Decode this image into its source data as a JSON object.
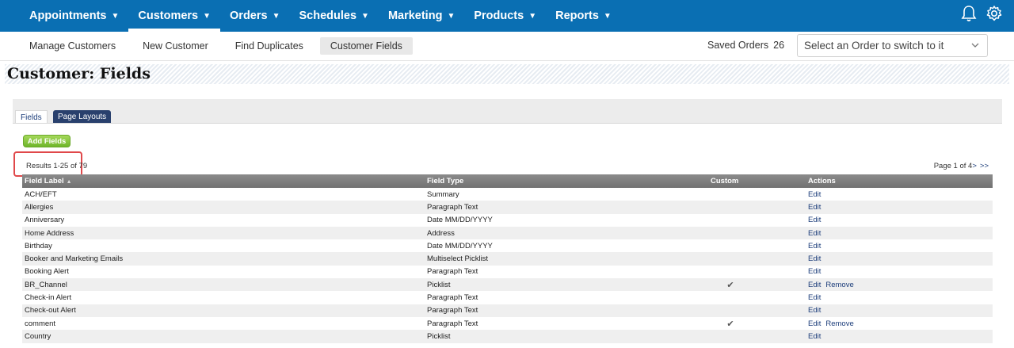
{
  "nav": {
    "items": [
      {
        "label": "Appointments",
        "caret": "▼"
      },
      {
        "label": "Customers",
        "caret": "▼",
        "active": true
      },
      {
        "label": "Orders",
        "caret": "▼"
      },
      {
        "label": "Schedules",
        "caret": "▼"
      },
      {
        "label": "Marketing",
        "caret": "▼"
      },
      {
        "label": "Products",
        "caret": "▼"
      },
      {
        "label": "Reports",
        "caret": "▼"
      }
    ],
    "icons": [
      "bell-icon",
      "gear-icon"
    ],
    "bg_color": "#0a6fb3"
  },
  "subnav": {
    "links": [
      "Manage Customers",
      "New Customer",
      "Find Duplicates",
      "Customer Fields"
    ],
    "active_link": "Customer Fields",
    "saved_orders_label": "Saved Orders",
    "saved_orders_count": "26",
    "order_select_placeholder": "Select an Order to switch to it"
  },
  "page": {
    "title": "Customer: Fields"
  },
  "tabs": {
    "fields": "Fields",
    "page_layouts": "Page Layouts"
  },
  "add_button": "Add Fields",
  "results_text": "Results 1-25 of 79",
  "pager": {
    "text": "Page 1 of 4",
    "next": ">",
    "last": ">>"
  },
  "table": {
    "headers": {
      "label": "Field Label",
      "sort_indicator": "▲",
      "type": "Field Type",
      "custom": "Custom",
      "actions": "Actions"
    },
    "rows": [
      {
        "label": "ACH/EFT",
        "type": "Summary",
        "custom": false,
        "actions": [
          "Edit"
        ]
      },
      {
        "label": "Allergies",
        "type": "Paragraph Text",
        "custom": false,
        "actions": [
          "Edit"
        ]
      },
      {
        "label": "Anniversary",
        "type": "Date MM/DD/YYYY",
        "custom": false,
        "actions": [
          "Edit"
        ]
      },
      {
        "label": "Home Address",
        "type": "Address",
        "custom": false,
        "actions": [
          "Edit"
        ]
      },
      {
        "label": "Birthday",
        "type": "Date MM/DD/YYYY",
        "custom": false,
        "actions": [
          "Edit"
        ]
      },
      {
        "label": "Booker and Marketing Emails",
        "type": "Multiselect Picklist",
        "custom": false,
        "actions": [
          "Edit"
        ]
      },
      {
        "label": "Booking Alert",
        "type": "Paragraph Text",
        "custom": false,
        "actions": [
          "Edit"
        ]
      },
      {
        "label": "BR_Channel",
        "type": "Picklist",
        "custom": true,
        "actions": [
          "Edit",
          "Remove"
        ]
      },
      {
        "label": "Check-in Alert",
        "type": "Paragraph Text",
        "custom": false,
        "actions": [
          "Edit"
        ]
      },
      {
        "label": "Check-out Alert",
        "type": "Paragraph Text",
        "custom": false,
        "actions": [
          "Edit"
        ]
      },
      {
        "label": "comment",
        "type": "Paragraph Text",
        "custom": true,
        "actions": [
          "Edit",
          "Remove"
        ]
      },
      {
        "label": "Country",
        "type": "Picklist",
        "custom": false,
        "actions": [
          "Edit"
        ]
      }
    ]
  }
}
